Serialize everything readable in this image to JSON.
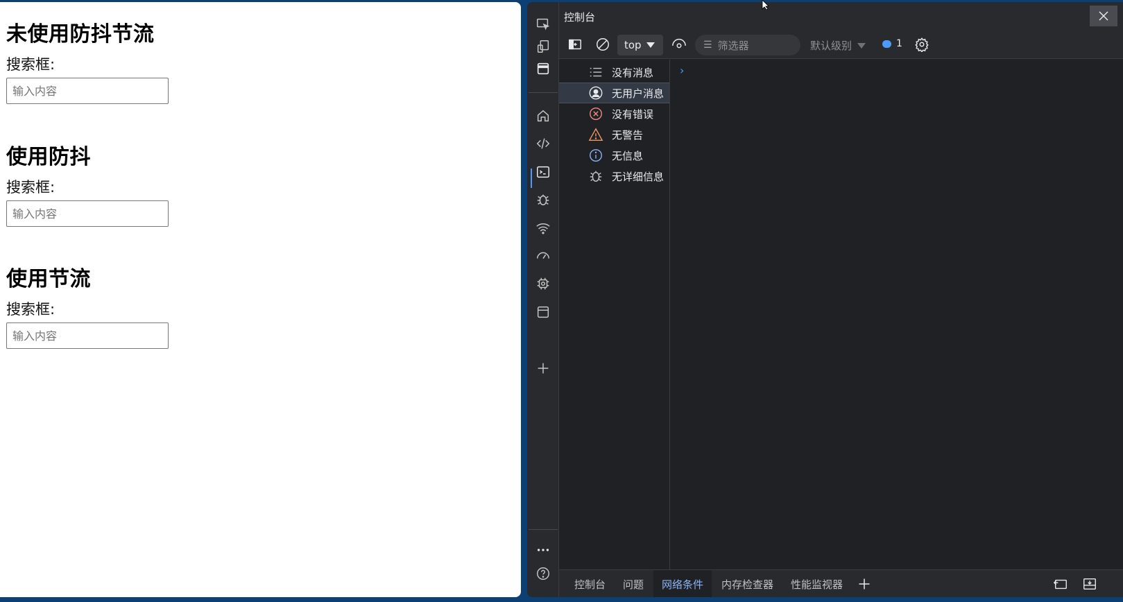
{
  "page": {
    "sections": [
      {
        "title": "未使用防抖节流",
        "label": "搜索框:",
        "placeholder": "输入内容"
      },
      {
        "title": "使用防抖",
        "label": "搜索框:",
        "placeholder": "输入内容"
      },
      {
        "title": "使用节流",
        "label": "搜索框:",
        "placeholder": "输入内容"
      }
    ]
  },
  "devtools": {
    "title": "控制台",
    "toolbar": {
      "context": "top",
      "filter_placeholder": "筛选器",
      "level": "默认级别",
      "message_count": "1"
    },
    "sidebar": {
      "items": [
        {
          "label": "没有消息",
          "icon": "list-icon"
        },
        {
          "label": "无用户消息",
          "icon": "user-icon"
        },
        {
          "label": "没有错误",
          "icon": "error-icon"
        },
        {
          "label": "无警告",
          "icon": "warning-icon"
        },
        {
          "label": "无信息",
          "icon": "info-icon"
        },
        {
          "label": "无详细信息",
          "icon": "bug-icon"
        }
      ]
    },
    "bottom_tabs": [
      "控制台",
      "问题",
      "网络条件",
      "内存检查器",
      "性能监视器"
    ],
    "active_bottom_tab": "网络条件"
  },
  "colors": {
    "devtools_bg": "#202124",
    "accent": "#4c9aff",
    "error": "#f28b82",
    "warning": "#f29766"
  }
}
